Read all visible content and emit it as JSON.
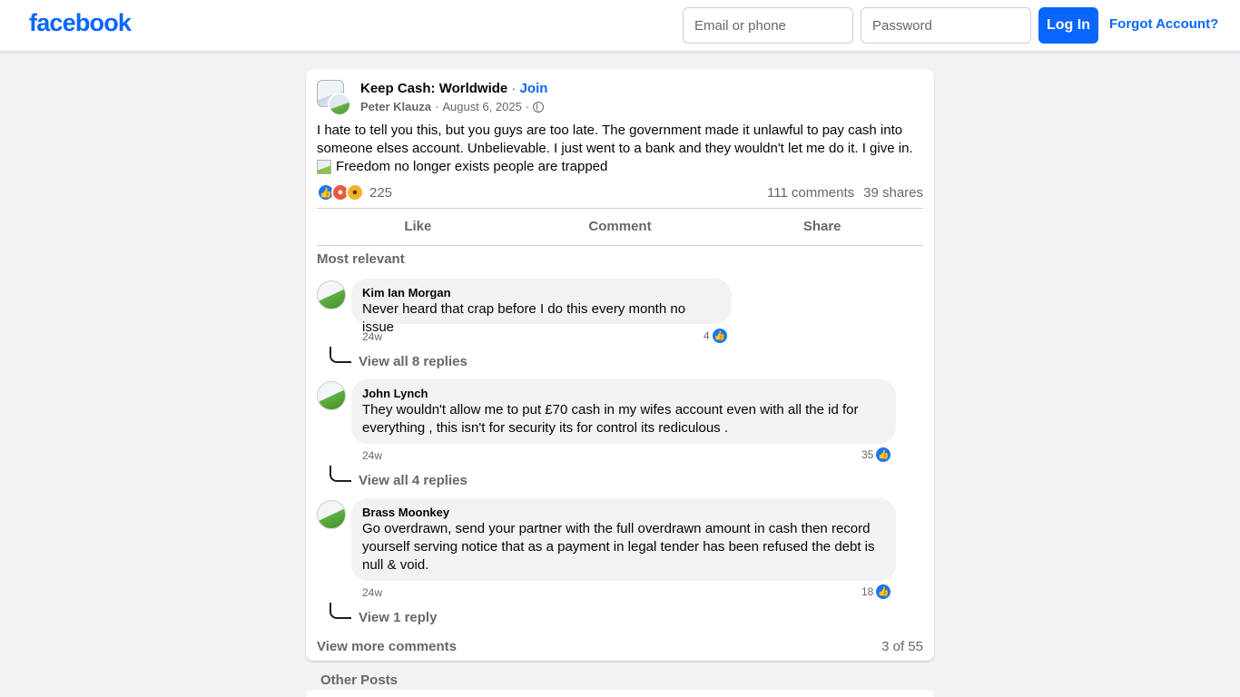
{
  "header": {
    "logo": "facebook",
    "email_placeholder": "Email or phone",
    "password_placeholder": "Password",
    "login_label": "Log In",
    "forgot_label": "Forgot Account?"
  },
  "post": {
    "group_name": "Keep Cash: Worldwide",
    "separator": "·",
    "join_label": "Join",
    "author": "Peter Klauza",
    "date": "August 6, 2025",
    "privacy_icon": "globe-icon",
    "text": "I hate to tell you this, but you guys are too late. The government made it unlawful to pay cash into someone elses account. Unbelievable. I just went to a bank and they wouldn't let me do it. I give in.",
    "image_caption": "Freedom no longer exists people are trapped",
    "reaction_count": "225",
    "comments_count": "111 comments",
    "shares_count": "39 shares",
    "actions": {
      "like": "Like",
      "comment": "Comment",
      "share": "Share"
    },
    "sort_label": "Most relevant"
  },
  "comments": [
    {
      "name": "Kim Ian Morgan",
      "text": "Never heard that crap before I do this every month no issue",
      "time": "24w",
      "likes": "4",
      "replies_label": "View all 8 replies"
    },
    {
      "name": "John Lynch",
      "text": "They wouldn't allow me to put £70 cash in my wifes account even with all the id for everything , this isn't for security its for control its rediculous .",
      "time": "24w",
      "likes": "35",
      "replies_label": "View all 4 replies"
    },
    {
      "name": "Brass Moonkey",
      "text": "Go overdrawn, send your partner with the full overdrawn amount in cash then record yourself serving notice that as a payment in legal tender has been refused the debt is null & void.",
      "time": "24w",
      "likes": "18",
      "replies_label": "View 1 reply"
    }
  ],
  "footer": {
    "view_more": "View more comments",
    "page_count": "3 of 55",
    "other_posts": "Other Posts"
  },
  "colors": {
    "brand": "#0866ff",
    "background": "#f0f2f5",
    "muted_text": "#65676b"
  }
}
